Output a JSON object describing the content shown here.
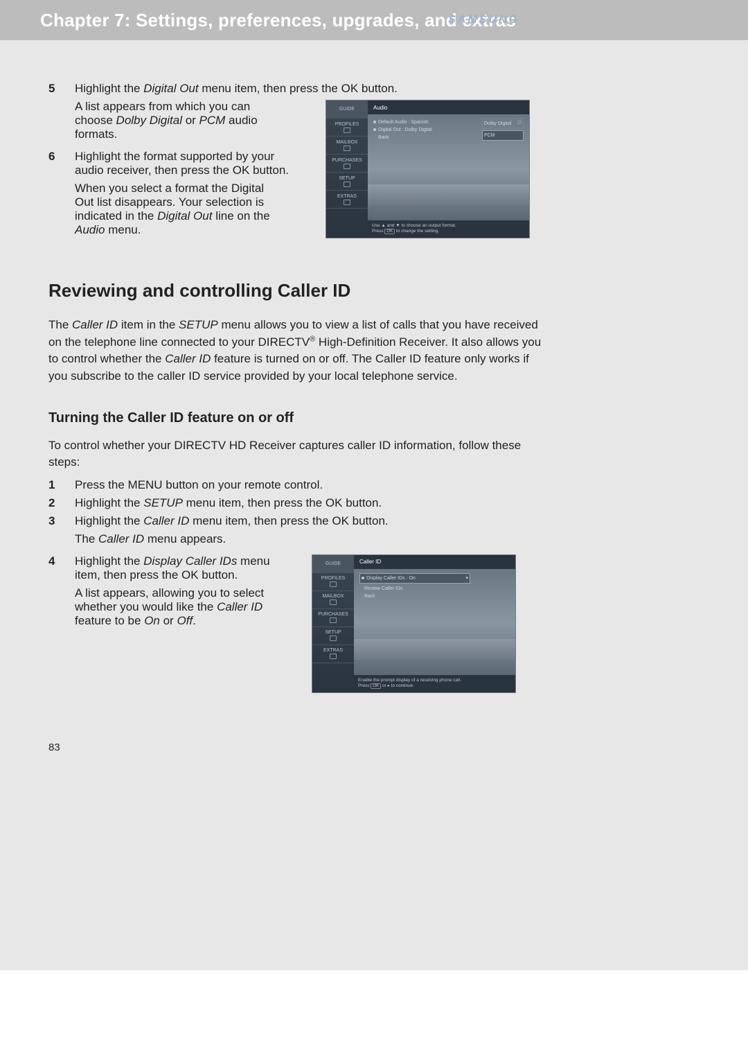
{
  "header": {
    "chapter_title": "Chapter 7: Settings, preferences, upgrades, and extras",
    "brand": "SAMSUNG"
  },
  "step5": {
    "num": "5",
    "line1_a": "Highlight the ",
    "line1_b": "Digital Out",
    "line1_c": " menu item, then press the OK button.",
    "para_a": "A list appears from which you can choose ",
    "para_b": "Dolby Digital",
    "para_c": " or ",
    "para_d": "PCM",
    "para_e": " audio formats."
  },
  "step6": {
    "num": "6",
    "line1": "Highlight the format supported by your audio receiver, then press the OK button.",
    "para_a": "When you select a format the Digital Out list disappears. Your selection is indicated in the ",
    "para_b": "Digital Out",
    "para_c": " line on the ",
    "para_d": "Audio",
    "para_e": " menu."
  },
  "screenshot1": {
    "sidebar": [
      "GUIDE",
      "PROFILES",
      "MAILBOX",
      "PURCHASES",
      "SETUP",
      "EXTRAS"
    ],
    "title": "Audio",
    "rows": {
      "default_audio": "Default Audio : Spanish",
      "digital_out": "Digital Out : Dolby Digital",
      "back": "Back"
    },
    "options": [
      "Dolby Digital",
      "PCM"
    ],
    "footer_a": "Use ▲ and ▼ to choose an output format.",
    "footer_b": "Press OK to change the setting."
  },
  "section_caller": {
    "h2": "Reviewing and controlling Caller ID",
    "para_a": "The ",
    "para_b": "Caller ID",
    "para_c": " item in the ",
    "para_d": "SETUP",
    "para_e": " menu allows you to view a list of calls that you have received on the telephone line connected to your DIRECTV",
    "para_f": "®",
    "para_g": " High-Definition Receiver. It also allows you to control whether the ",
    "para_h": "Caller ID",
    "para_i": " feature is turned on or off. The Caller ID feature only works if you subscribe to the caller ID service provided by your local telephone service."
  },
  "section_turn": {
    "h3": "Turning the Caller ID feature on or off",
    "intro": "To control whether your DIRECTV HD Receiver captures caller ID information, follow these steps:"
  },
  "steps_caller": {
    "s1": {
      "num": "1",
      "text": "Press the MENU button on your remote control."
    },
    "s2": {
      "num": "2",
      "text_a": "Highlight the ",
      "text_b": "SETUP",
      "text_c": " menu item, then press the OK button."
    },
    "s3": {
      "num": "3",
      "text_a": "Highlight the ",
      "text_b": "Caller ID",
      "text_c": " menu item, then press the OK button.",
      "sub_a": "The ",
      "sub_b": "Caller ID",
      "sub_c": " menu appears."
    },
    "s4": {
      "num": "4",
      "text_a": "Highlight the ",
      "text_b": "Display Caller IDs",
      "text_c": " menu item, then press the OK button.",
      "para_a": "A list appears, allowing you to select whether you would like the ",
      "para_b": "Caller ID",
      "para_c": " feature to be ",
      "para_d": "On",
      "para_e": " or ",
      "para_f": "Off",
      "para_g": "."
    }
  },
  "screenshot2": {
    "sidebar": [
      "GUIDE",
      "PROFILES",
      "MAILBOX",
      "PURCHASES",
      "SETUP",
      "EXTRAS"
    ],
    "title": "Caller ID",
    "rows": {
      "display": "Display Caller IDs : On",
      "review": "Review Caller IDs",
      "back": "Back"
    },
    "footer_a": "Enable the prompt display of a receiving phone call.",
    "footer_b": "Press OK or ▶ to continue."
  },
  "page_number": "83"
}
